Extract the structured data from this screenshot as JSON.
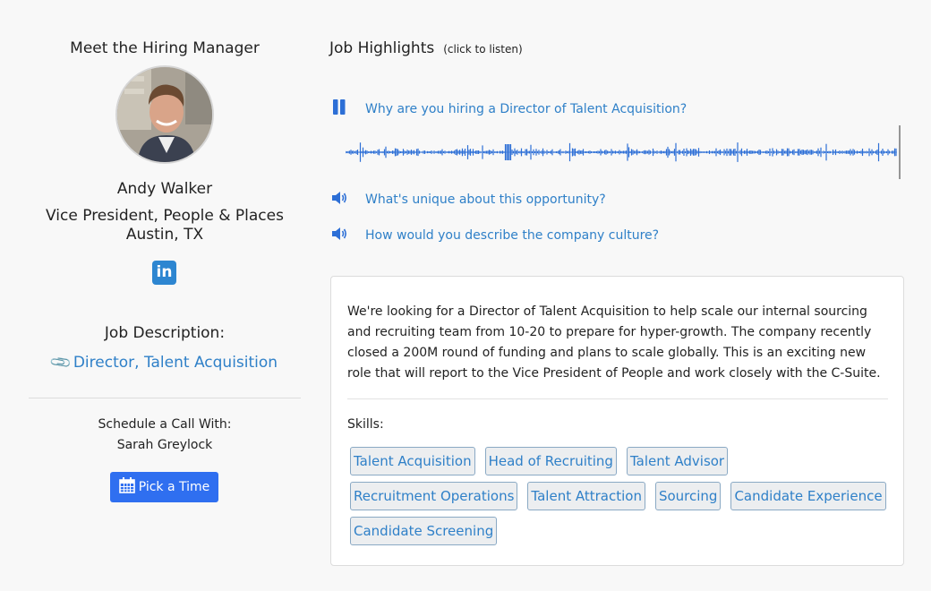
{
  "manager": {
    "heading": "Meet the Hiring Manager",
    "name": "Andy Walker",
    "title": "Vice President, People & Places",
    "location": "Austin, TX",
    "linkedin_icon": "linkedin-icon"
  },
  "job_description": {
    "heading": "Job Description:",
    "link": "Director, Talent Acquisition"
  },
  "schedule": {
    "label": "Schedule a Call With:",
    "name": "Sarah Greylock",
    "button": "Pick a Time"
  },
  "highlights": {
    "heading": "Job Highlights",
    "sub": "(click to listen)",
    "questions": [
      {
        "text": "Why are you hiring a Director of Talent Acquisition?",
        "icon": "pause-icon"
      },
      {
        "text": "What's unique about this opportunity?",
        "icon": "speaker-icon"
      },
      {
        "text": "How would you describe the company culture?",
        "icon": "speaker-icon"
      }
    ]
  },
  "description": "We're looking for a Director of Talent Acquisition to help scale our internal sourcing and recruiting team from 10-20 to prepare for hyper-growth. The company recently closed a 200M round of funding and plans to scale globally. This is an exciting new role that will report to the Vice President of People and work closely with the C-Suite.",
  "skills": {
    "label": "Skills:",
    "items": [
      "Talent Acquisition",
      "Head of Recruiting",
      "Talent Advisor",
      "Recruitment Operations",
      "Talent Attraction",
      "Sourcing",
      "Candidate Experience",
      "Candidate Screening"
    ]
  },
  "colors": {
    "accent": "#2f80c8",
    "button": "#2f6ff0",
    "waveform": "#2d6fd6"
  }
}
